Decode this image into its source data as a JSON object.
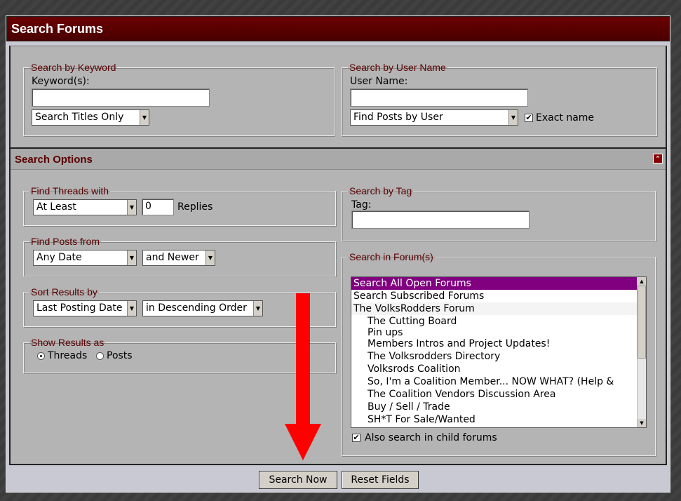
{
  "title": "Search Forums",
  "keyword_section": {
    "legend": "Search by Keyword",
    "label": "Keyword(s):",
    "value": "",
    "mode": "Search Titles Only"
  },
  "user_section": {
    "legend": "Search by User Name",
    "label": "User Name:",
    "value": "",
    "mode": "Find Posts by User",
    "exact_label": "Exact name",
    "exact_checked": true
  },
  "search_options": {
    "title": "Search Options"
  },
  "find_threads": {
    "legend": "Find Threads with",
    "comparator": "At Least",
    "count": "0",
    "unit": "Replies"
  },
  "find_posts": {
    "legend": "Find Posts from",
    "date": "Any Date",
    "direction": "and Newer"
  },
  "sort_results": {
    "legend": "Sort Results by",
    "field": "Last Posting Date",
    "order": "in Descending Order"
  },
  "show_results": {
    "legend": "Show Results as",
    "options": [
      "Threads",
      "Posts"
    ],
    "selected": "Threads"
  },
  "tag_section": {
    "legend": "Search by Tag",
    "label": "Tag:",
    "value": ""
  },
  "forums_section": {
    "legend": "Search in Forum(s)",
    "items": [
      "Search All Open Forums",
      "Search Subscribed Forums",
      "The VolksRodders Forum",
      "The Cutting Board",
      "Pin ups",
      "Members Intros and Project Updates!",
      "The Volksrodders Directory",
      "Volksrods Coalition",
      "So, I'm a Coalition Member... NOW WHAT? (Help &",
      "The Coalition Vendors Discussion Area",
      "Buy / Sell / Trade",
      "SH*T For Sale/Wanted"
    ],
    "selected_index": 0,
    "child_label": "Also search in child forums",
    "child_checked": true
  },
  "buttons": {
    "search": "Search Now",
    "reset": "Reset Fields"
  },
  "colors": {
    "title_bar": "#5a0000",
    "selected_item": "#800080",
    "annotation_arrow": "#ff0000"
  }
}
